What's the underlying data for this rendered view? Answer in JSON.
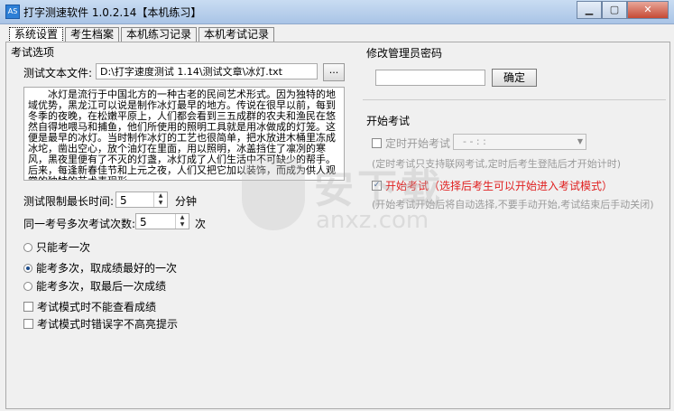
{
  "window": {
    "title": "打字测速软件 1.0.2.14【本机练习】",
    "min": "▁",
    "max": "▢",
    "close": "✕"
  },
  "tabs": [
    "系统设置",
    "考生档案",
    "本机练习记录",
    "本机考试记录"
  ],
  "left": {
    "group_title": "考试选项",
    "file_label": "测试文本文件:",
    "file_value": "D:\\打字速度测试 1.14\\测试文章\\冰灯.txt",
    "browse_label": "...",
    "text_content": "冰灯是流行于中国北方的一种古老的民间艺术形式。因为独特的地域优势，黑龙江可以说是制作冰灯最早的地方。传说在很早以前，每到冬季的夜晚，在松嫩平原上，人们都会看到三五成群的农夫和渔民在悠然自得地喂马和捕鱼，他们所使用的照明工具就是用冰做成的灯笼。这便是最早的冰灯。当时制作冰灯的工艺也很简单，把水放进木桶里冻成冰坨，凿出空心，放个油灯在里面，用以照明，冰盖挡住了凛冽的寒风，黑夜里便有了不灭的灯盏，冰灯成了人们生活中不可缺少的帮手。后来，每逢新春佳节和上元之夜，人们又把它加以装饰，而成为供人观赏的独特的艺术表现形",
    "time_label": "测试限制最长时间:",
    "time_value": "5",
    "time_unit": "分钟",
    "attempts_label": "同一考号多次考试次数:",
    "attempts_value": "5",
    "attempts_unit": "次",
    "radios": [
      {
        "label": "只能考一次",
        "checked": false
      },
      {
        "label": "能考多次，取成绩最好的一次",
        "checked": true
      },
      {
        "label": "能考多次，取最后一次成绩",
        "checked": false
      }
    ],
    "checks": [
      {
        "label": "考试模式时不能查看成绩",
        "checked": false
      },
      {
        "label": "考试模式时错误字不高亮提示",
        "checked": false
      }
    ]
  },
  "right": {
    "pw_title": "修改管理员密码",
    "ok_label": "确定",
    "exam_title": "开始考试",
    "timed_label": "定时开始考试",
    "timed_value": "- -   : :",
    "timed_note": "(定时考试只支持联网考试,定时后考生登陆后才开始计时)",
    "start_label": "开始考试（选择后考生可以开始进入考试模式）",
    "start_checked": true,
    "start_note": "(开始考试开始后将自动选择,不要手动开始,考试结束后手动关闭)"
  },
  "watermark": {
    "text": "安下载",
    "url": "anxz.com"
  },
  "colors": {
    "accent": "#2d7fd6",
    "warning": "#e02020",
    "disabled": "#9a9a9a"
  }
}
